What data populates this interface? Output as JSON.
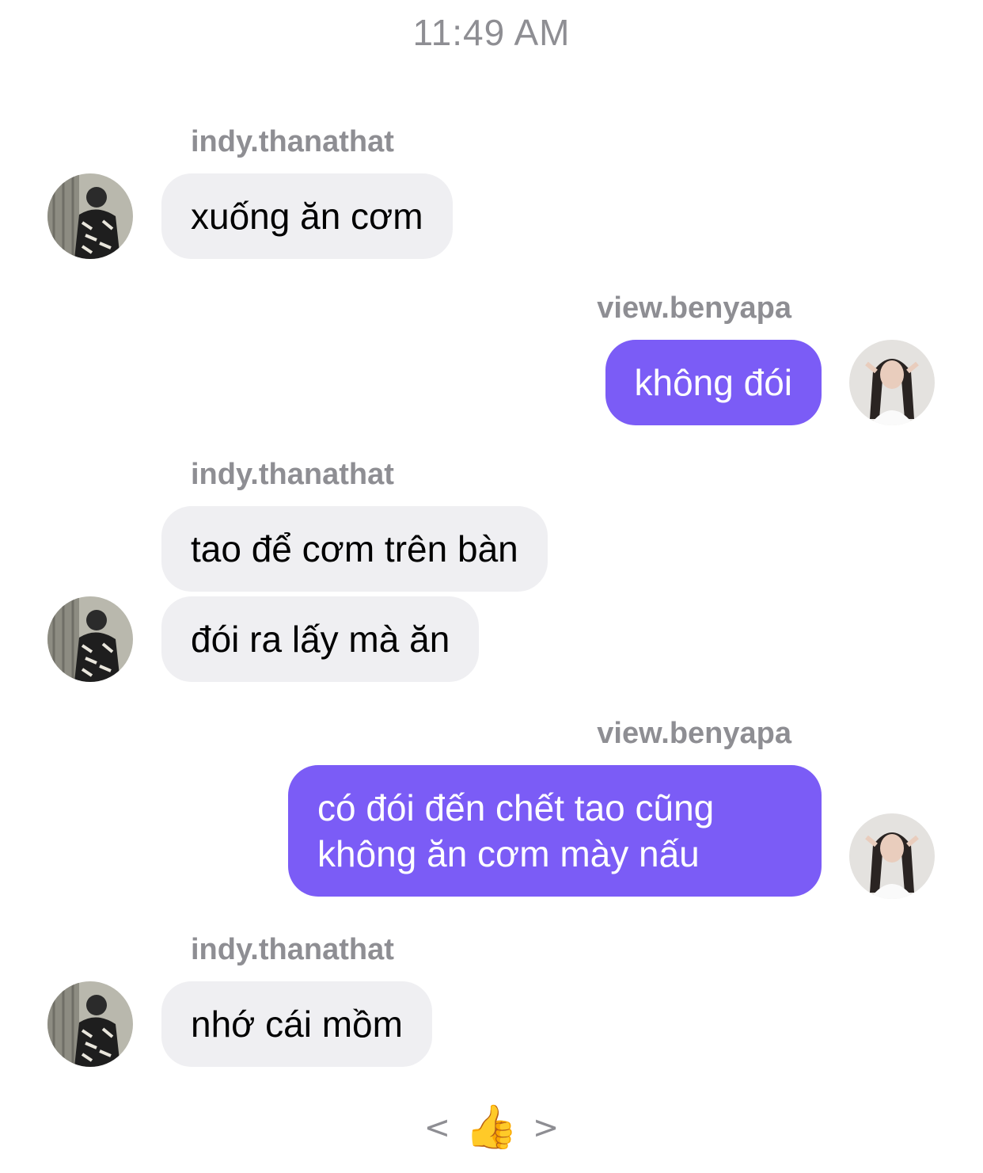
{
  "timestamp": "11:49 AM",
  "participants": {
    "other": "indy.thanathat",
    "me": "view.benyapa"
  },
  "messages": [
    {
      "sender": "indy.thanathat",
      "text": "xuống ăn cơm"
    },
    {
      "sender": "view.benyapa",
      "text": "không đói"
    },
    {
      "sender": "indy.thanathat",
      "text": "tao để cơm trên bàn"
    },
    {
      "sender": "indy.thanathat",
      "text": "đói ra lấy mà ăn"
    },
    {
      "sender": "view.benyapa",
      "text": "có đói đến chết tao cũng không ăn cơm mày nấu"
    },
    {
      "sender": "indy.thanathat",
      "text": "nhớ cái mồm"
    }
  ],
  "reaction_bar": {
    "prev": "<",
    "emoji": "👍",
    "next": ">"
  },
  "colors": {
    "outgoing_bubble": "#7b5cf6",
    "incoming_bubble": "#efeff2",
    "meta_text": "#8e8e93"
  },
  "icons": {
    "avatar_other": "avatar-indy-thanathat",
    "avatar_me": "avatar-view-benyapa"
  }
}
